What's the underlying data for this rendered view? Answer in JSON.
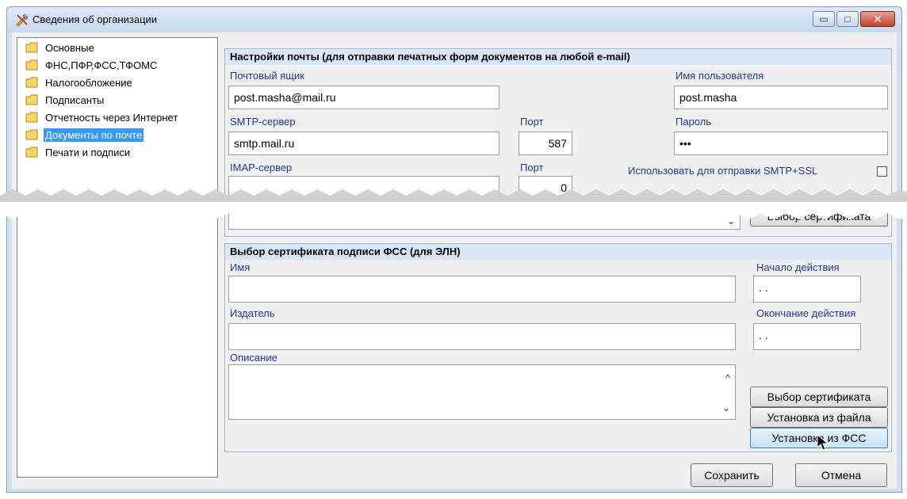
{
  "window": {
    "title": "Сведения об организации",
    "minimize_glyph": "▭",
    "maximize_glyph": "□",
    "close_glyph": "✕"
  },
  "tree": {
    "items": [
      {
        "label": "Основные"
      },
      {
        "label": "ФНС,ПФР,ФСС,ТФОМС"
      },
      {
        "label": "Налогообложение"
      },
      {
        "label": "Подписанты"
      },
      {
        "label": "Отчетность через Интернет"
      },
      {
        "label": "Документы по почте",
        "selected": true
      },
      {
        "label": "Печати и подписи"
      }
    ]
  },
  "mail": {
    "heading": "Настройки почты (для отправки печатных форм документов на любой e-mail)",
    "mailbox_label": "Почтовый ящик",
    "mailbox_value": "post.masha@mail.ru",
    "user_label": "Имя пользователя",
    "user_value": "post.masha",
    "smtp_label": "SMTP-сервер",
    "smtp_value": "smtp.mail.ru",
    "smtp_port_label": "Порт",
    "smtp_port_value": "587",
    "password_label": "Пароль",
    "password_value": "•••",
    "imap_label": "IMAP-сервер",
    "imap_value": "",
    "imap_port_label": "Порт",
    "imap_port_value": "0",
    "ssl_label": "Использовать для отправки SMTP+SSL",
    "ssl_checked": false,
    "cert_button": "Выбор сертификата",
    "dropdown_glyph": "⌄"
  },
  "fss": {
    "heading": "Выбор сертификата подписи ФСС (для ЭЛН)",
    "name_label": "Имя",
    "name_value": "",
    "start_label": "Начало действия",
    "start_value": ". .",
    "issuer_label": "Издатель",
    "issuer_value": "",
    "end_label": "Окончание действия",
    "end_value": ". .",
    "desc_label": "Описание",
    "desc_value": "",
    "btn_choose": "Выбор сертификата",
    "btn_file": "Установка из файла",
    "btn_fss": "Установка из ФСС",
    "scroll_up": "^",
    "scroll_down": "⌄"
  },
  "footer": {
    "save": "Сохранить",
    "cancel": "Отмена"
  },
  "colors": {
    "selection": "#3399ff",
    "label_blue": "#1a3a9c",
    "group_header": "#d8e6f6"
  }
}
